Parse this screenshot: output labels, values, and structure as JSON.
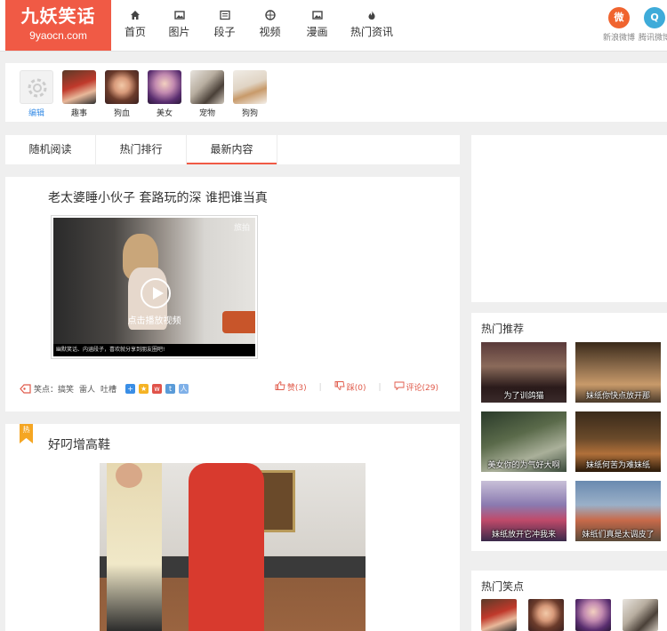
{
  "logo": {
    "title": "九妖笑话",
    "subtitle": "9yaocn.com"
  },
  "nav": [
    {
      "label": "首页",
      "icon": "home-icon"
    },
    {
      "label": "图片",
      "icon": "image-icon"
    },
    {
      "label": "段子",
      "icon": "text-icon"
    },
    {
      "label": "视频",
      "icon": "video-icon"
    },
    {
      "label": "漫画",
      "icon": "comic-icon"
    },
    {
      "label": "热门资讯",
      "icon": "flame-icon"
    }
  ],
  "weibo": [
    {
      "label": "新浪微博",
      "icon": "sina-weibo-icon",
      "color": "#f0642f"
    },
    {
      "label": "腾讯微博",
      "icon": "tencent-weibo-icon",
      "color": "#3eabd9"
    }
  ],
  "categories": [
    {
      "label": "编辑"
    },
    {
      "label": "趣事"
    },
    {
      "label": "狗血"
    },
    {
      "label": "美女"
    },
    {
      "label": "宠物"
    },
    {
      "label": "狗狗"
    }
  ],
  "tabs": [
    {
      "label": "随机阅读",
      "active": false
    },
    {
      "label": "热门排行",
      "active": false
    },
    {
      "label": "最新内容",
      "active": true
    }
  ],
  "post1": {
    "title": "老太婆睡小伙子 套路玩的深 谁把谁当真",
    "play_text": "点击播放视频",
    "video_caption": "幽默笑话、内涵段子，喜欢就分享到朋友圈吧!",
    "video_watermark": "旅拍",
    "tag_label": "笑点：",
    "tags": [
      "搞笑",
      "雷人",
      "吐槽"
    ],
    "like": "赞(3)",
    "dislike": "踩(0)",
    "comment": "评论(29)"
  },
  "post2": {
    "badge": "热",
    "title": "好叼增高鞋"
  },
  "sidebar": {
    "hot_recommend": {
      "title": "热门推荐",
      "items": [
        {
          "caption": "为了训鸽猫"
        },
        {
          "caption": "妹纸你快点放开那"
        },
        {
          "caption": "美女你的为气好大啊"
        },
        {
          "caption": "妹纸何苦为难妹纸"
        },
        {
          "caption": "妹纸放开它冲我来"
        },
        {
          "caption": "妹纸们真是太调皮了"
        }
      ]
    },
    "hot_points": {
      "title": "热门笑点"
    }
  },
  "colors": {
    "brand": "#f05a45",
    "accent_badge": "#f5a623",
    "background": "#efefef"
  }
}
